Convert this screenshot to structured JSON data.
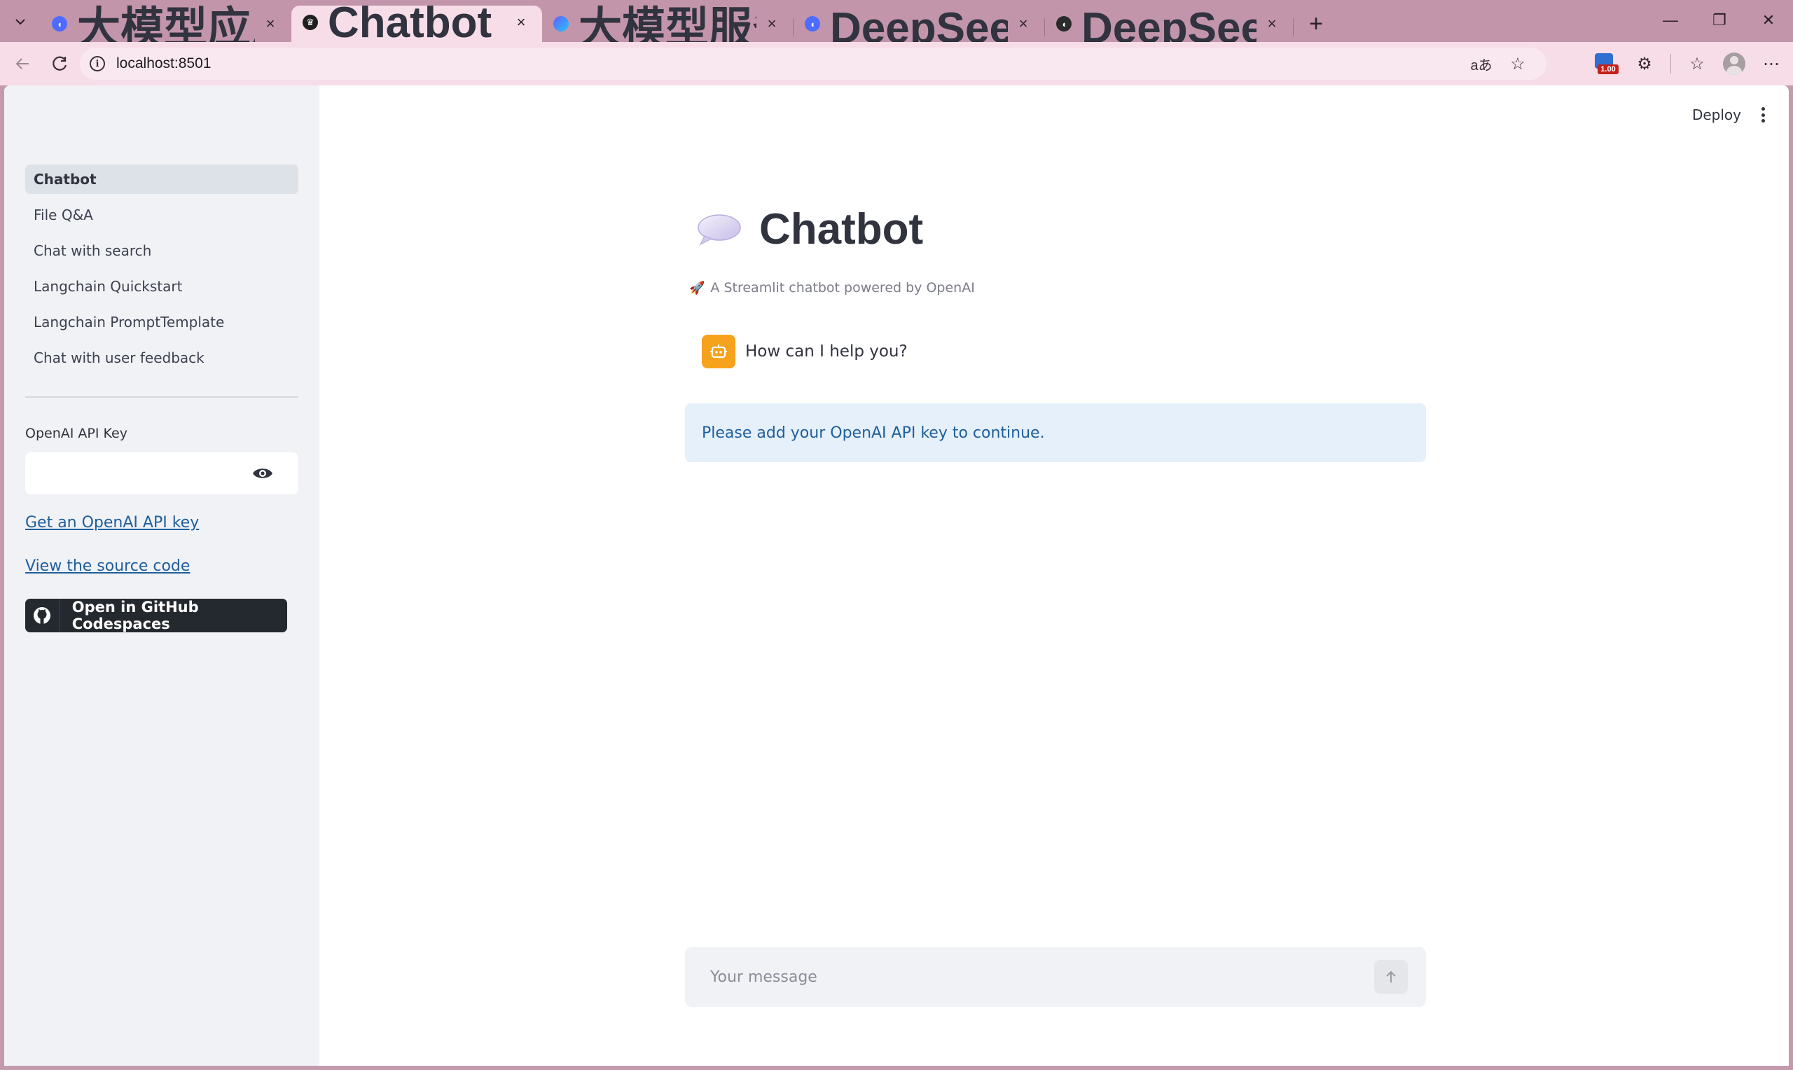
{
  "browser": {
    "tabs": [
      {
        "title": "大模型应用开发实战指南 - DeepSeek",
        "favicon": "deepseek-icon",
        "active": false
      },
      {
        "title": "Chatbot",
        "favicon": "streamlit-icon",
        "active": true
      },
      {
        "title": "大模型服务平台百炼控制台",
        "favicon": "bailian-icon",
        "active": false
      },
      {
        "title": "DeepSeek | 深度求索",
        "favicon": "deepseek-icon",
        "active": false
      },
      {
        "title": "DeepSeek 开放平台",
        "favicon": "deepseek-icon",
        "active": false
      }
    ],
    "url": "localhost:8501",
    "extension_badge": "1.00"
  },
  "sidebar": {
    "nav": [
      {
        "label": "Chatbot",
        "active": true
      },
      {
        "label": "File Q&A",
        "active": false
      },
      {
        "label": "Chat with search",
        "active": false
      },
      {
        "label": "Langchain Quickstart",
        "active": false
      },
      {
        "label": "Langchain PromptTemplate",
        "active": false
      },
      {
        "label": "Chat with user feedback",
        "active": false
      }
    ],
    "api_key_label": "OpenAI API Key",
    "api_key_value": "",
    "link_get_key": "Get an OpenAI API key",
    "link_source": "View the source code",
    "codespaces_button": "Open in GitHub Codespaces"
  },
  "header": {
    "deploy_label": "Deploy"
  },
  "main": {
    "title": "Chatbot",
    "caption": "A Streamlit chatbot powered by OpenAI",
    "messages": [
      {
        "role": "assistant",
        "text": "How can I help you?"
      }
    ],
    "info": "Please add your OpenAI API key to continue.",
    "input_placeholder": "Your message"
  },
  "colors": {
    "sidebar_bg": "#f0f2f6",
    "link": "#1f5f9c",
    "info_bg": "#e6f0fb",
    "bot_avatar": "#f7a21c",
    "browser_frame": "#c295ab"
  }
}
